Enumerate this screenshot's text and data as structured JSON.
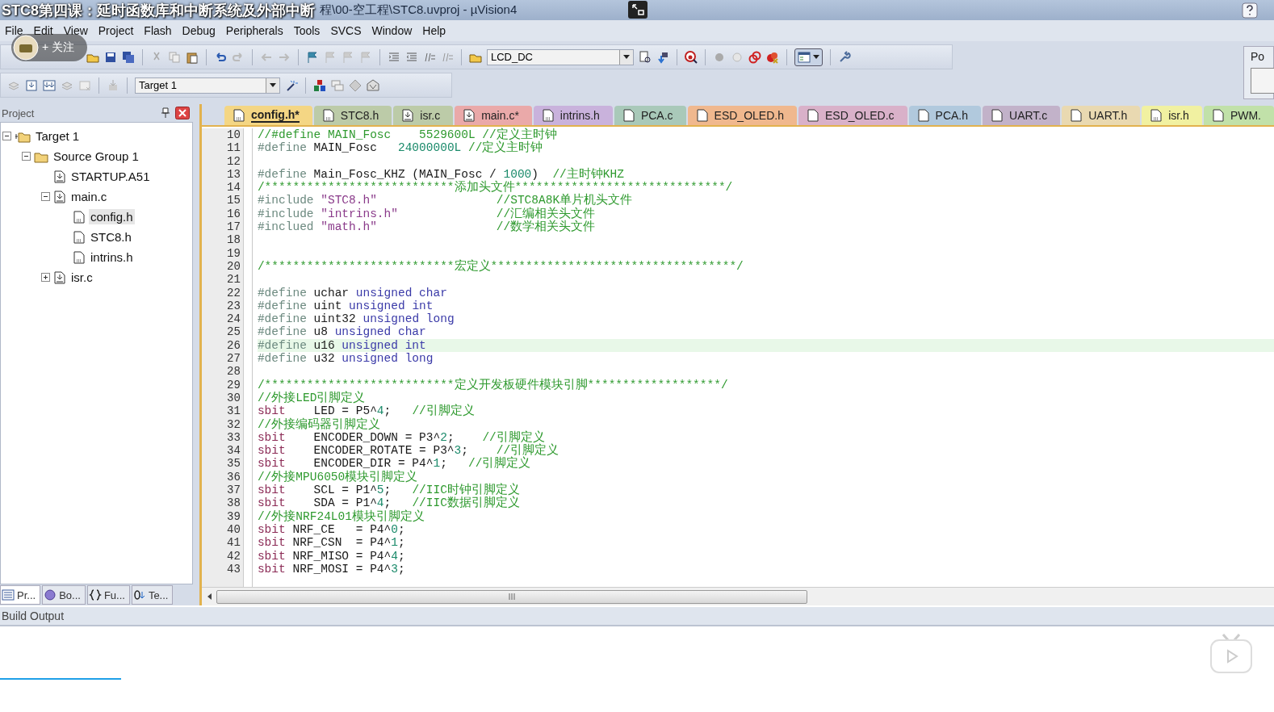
{
  "video_overlay": {
    "title": "STC8第四课：延时函数库和中断系统及外部中断",
    "follow_button": "+ 关注"
  },
  "window": {
    "title": "程\\00-空工程\\STC8.uvproj - µVision4"
  },
  "menu": [
    "File",
    "Edit",
    "View",
    "Project",
    "Flash",
    "Debug",
    "Peripherals",
    "Tools",
    "SVCS",
    "Window",
    "Help"
  ],
  "toolbar": {
    "device_combo": "LCD_DC",
    "target_combo": "Target 1"
  },
  "right_panel": {
    "label": "Po"
  },
  "side_panel": {
    "title": "Project",
    "tree": [
      {
        "label": "Target 1",
        "kind": "target",
        "expanded": true,
        "selected": false,
        "children": [
          {
            "label": "Source Group 1",
            "kind": "group",
            "expanded": true,
            "selected": false,
            "children": [
              {
                "label": "STARTUP.A51",
                "kind": "source",
                "selected": false
              },
              {
                "label": "main.c",
                "kind": "source",
                "expanded": true,
                "selected": false,
                "children": [
                  {
                    "label": "config.h",
                    "kind": "header",
                    "selected": true
                  },
                  {
                    "label": "STC8.h",
                    "kind": "header",
                    "selected": false
                  },
                  {
                    "label": "intrins.h",
                    "kind": "header",
                    "selected": false
                  }
                ]
              },
              {
                "label": "isr.c",
                "kind": "source",
                "expanded": false,
                "selected": false
              }
            ]
          }
        ]
      }
    ],
    "tabs": [
      {
        "label": "Pr...",
        "kind": "project",
        "selected": true
      },
      {
        "label": "Bo...",
        "kind": "books",
        "selected": false
      },
      {
        "label": "Fu...",
        "kind": "functions",
        "selected": false
      },
      {
        "label": "Te...",
        "kind": "templates",
        "selected": false
      }
    ]
  },
  "editor": {
    "tabs": [
      {
        "label": "config.h*",
        "kind": "header",
        "color": "#f4d684",
        "selected": true
      },
      {
        "label": "STC8.h",
        "kind": "header",
        "color": "#bccba8",
        "selected": false
      },
      {
        "label": "isr.c",
        "kind": "source",
        "color": "#bccba8",
        "selected": false
      },
      {
        "label": "main.c*",
        "kind": "source",
        "color": "#eaa9a9",
        "selected": false
      },
      {
        "label": "intrins.h",
        "kind": "header",
        "color": "#c9b2dc",
        "selected": false
      },
      {
        "label": "PCA.c",
        "kind": "plain",
        "color": "#a9c9b9",
        "selected": false
      },
      {
        "label": "ESD_OLED.h",
        "kind": "plain",
        "color": "#f0b88e",
        "selected": false
      },
      {
        "label": "ESD_OLED.c",
        "kind": "plain",
        "color": "#d9b1c9",
        "selected": false
      },
      {
        "label": "PCA.h",
        "kind": "plain",
        "color": "#b1c9dd",
        "selected": false
      },
      {
        "label": "UART.c",
        "kind": "plain",
        "color": "#c2b2c9",
        "selected": false
      },
      {
        "label": "UART.h",
        "kind": "plain",
        "color": "#e9d9b1",
        "selected": false
      },
      {
        "label": "isr.h",
        "kind": "header",
        "color": "#f1f1a1",
        "selected": false
      },
      {
        "label": "PWM.",
        "kind": "plain",
        "color": "#c1e1a9",
        "selected": false
      }
    ],
    "lines": [
      {
        "number": "10",
        "current": false,
        "tokens": [
          {
            "kind": "comment",
            "text": "//#define MAIN_Fosc    5529600L //定义主时钟"
          }
        ]
      },
      {
        "number": "11",
        "current": false,
        "tokens": [
          {
            "kind": "directive",
            "text": "#define"
          },
          {
            "kind": "plain",
            "text": " MAIN_Fosc   "
          },
          {
            "kind": "number",
            "text": "24000000L"
          },
          {
            "kind": "comment",
            "text": " //定义主时钟"
          }
        ]
      },
      {
        "number": "12",
        "current": false
      },
      {
        "number": "13",
        "current": false,
        "tokens": [
          {
            "kind": "directive",
            "text": "#define"
          },
          {
            "kind": "plain",
            "text": " Main_Fosc_KHZ (MAIN_Fosc / "
          },
          {
            "kind": "number",
            "text": "1000"
          },
          {
            "kind": "plain",
            "text": ")  "
          },
          {
            "kind": "comment",
            "text": "//主时钟KHZ"
          }
        ]
      },
      {
        "number": "14",
        "current": false,
        "tokens": [
          {
            "kind": "comment",
            "text": "/***************************添加头文件******************************/"
          }
        ]
      },
      {
        "number": "15",
        "current": false,
        "tokens": [
          {
            "kind": "directive",
            "text": "#include"
          },
          {
            "kind": "string",
            "text": " \"STC8.h\""
          },
          {
            "kind": "comment",
            "text": "                 //STC8A8K单片机头文件"
          }
        ]
      },
      {
        "number": "16",
        "current": false,
        "tokens": [
          {
            "kind": "directive",
            "text": "#include"
          },
          {
            "kind": "string",
            "text": " \"intrins.h\""
          },
          {
            "kind": "comment",
            "text": "              //汇编相关头文件"
          }
        ]
      },
      {
        "number": "17",
        "current": false,
        "tokens": [
          {
            "kind": "directive",
            "text": "#inclued"
          },
          {
            "kind": "string",
            "text": " \"math.h\""
          },
          {
            "kind": "comment",
            "text": "                 //数学相关头文件"
          }
        ]
      },
      {
        "number": "18",
        "current": false
      },
      {
        "number": "19",
        "current": false
      },
      {
        "number": "20",
        "current": false,
        "tokens": [
          {
            "kind": "comment",
            "text": "/***************************宏定义***********************************/"
          }
        ]
      },
      {
        "number": "21",
        "current": false
      },
      {
        "number": "22",
        "current": false,
        "tokens": [
          {
            "kind": "directive",
            "text": "#define"
          },
          {
            "kind": "plain",
            "text": " uchar "
          },
          {
            "kind": "keyword",
            "text": "unsigned char"
          }
        ]
      },
      {
        "number": "23",
        "current": false,
        "tokens": [
          {
            "kind": "directive",
            "text": "#define"
          },
          {
            "kind": "plain",
            "text": " uint "
          },
          {
            "kind": "keyword",
            "text": "unsigned int"
          }
        ]
      },
      {
        "number": "24",
        "current": false,
        "tokens": [
          {
            "kind": "directive",
            "text": "#define"
          },
          {
            "kind": "plain",
            "text": " uint32 "
          },
          {
            "kind": "keyword",
            "text": "unsigned long"
          }
        ]
      },
      {
        "number": "25",
        "current": false,
        "tokens": [
          {
            "kind": "directive",
            "text": "#define"
          },
          {
            "kind": "plain",
            "text": " u8 "
          },
          {
            "kind": "keyword",
            "text": "unsigned char"
          }
        ]
      },
      {
        "number": "26",
        "current": true,
        "tokens": [
          {
            "kind": "directive",
            "text": "#define"
          },
          {
            "kind": "plain",
            "text": " u16 "
          },
          {
            "kind": "keyword",
            "text": "unsigned int"
          }
        ]
      },
      {
        "number": "27",
        "current": false,
        "tokens": [
          {
            "kind": "directive",
            "text": "#define"
          },
          {
            "kind": "plain",
            "text": " u32 "
          },
          {
            "kind": "keyword",
            "text": "unsigned long"
          }
        ]
      },
      {
        "number": "28",
        "current": false
      },
      {
        "number": "29",
        "current": false,
        "tokens": [
          {
            "kind": "comment",
            "text": "/***************************定义开发板硬件模块引脚*******************/"
          }
        ]
      },
      {
        "number": "30",
        "current": false,
        "tokens": [
          {
            "kind": "comment",
            "text": "//外接LED引脚定义"
          }
        ]
      },
      {
        "number": "31",
        "current": false,
        "tokens": [
          {
            "kind": "type",
            "text": "sbit"
          },
          {
            "kind": "plain",
            "text": "    LED = P5^"
          },
          {
            "kind": "number",
            "text": "4"
          },
          {
            "kind": "plain",
            "text": ";   "
          },
          {
            "kind": "comment",
            "text": "//引脚定义"
          }
        ]
      },
      {
        "number": "32",
        "current": false,
        "tokens": [
          {
            "kind": "comment",
            "text": "//外接编码器引脚定义"
          }
        ]
      },
      {
        "number": "33",
        "current": false,
        "tokens": [
          {
            "kind": "type",
            "text": "sbit"
          },
          {
            "kind": "plain",
            "text": "    ENCODER_DOWN = P3^"
          },
          {
            "kind": "number",
            "text": "2"
          },
          {
            "kind": "plain",
            "text": ";    "
          },
          {
            "kind": "comment",
            "text": "//引脚定义"
          }
        ]
      },
      {
        "number": "34",
        "current": false,
        "tokens": [
          {
            "kind": "type",
            "text": "sbit"
          },
          {
            "kind": "plain",
            "text": "    ENCODER_ROTATE = P3^"
          },
          {
            "kind": "number",
            "text": "3"
          },
          {
            "kind": "plain",
            "text": ";    "
          },
          {
            "kind": "comment",
            "text": "//引脚定义"
          }
        ]
      },
      {
        "number": "35",
        "current": false,
        "tokens": [
          {
            "kind": "type",
            "text": "sbit"
          },
          {
            "kind": "plain",
            "text": "    ENCODER_DIR = P4^"
          },
          {
            "kind": "number",
            "text": "1"
          },
          {
            "kind": "plain",
            "text": ";   "
          },
          {
            "kind": "comment",
            "text": "//引脚定义"
          }
        ]
      },
      {
        "number": "36",
        "current": false,
        "tokens": [
          {
            "kind": "comment",
            "text": "//外接MPU6050模块引脚定义"
          }
        ]
      },
      {
        "number": "37",
        "current": false,
        "tokens": [
          {
            "kind": "type",
            "text": "sbit"
          },
          {
            "kind": "plain",
            "text": "    SCL = P1^"
          },
          {
            "kind": "number",
            "text": "5"
          },
          {
            "kind": "plain",
            "text": ";   "
          },
          {
            "kind": "comment",
            "text": "//IIC时钟引脚定义"
          }
        ]
      },
      {
        "number": "38",
        "current": false,
        "tokens": [
          {
            "kind": "type",
            "text": "sbit"
          },
          {
            "kind": "plain",
            "text": "    SDA = P1^"
          },
          {
            "kind": "number",
            "text": "4"
          },
          {
            "kind": "plain",
            "text": ";   "
          },
          {
            "kind": "comment",
            "text": "//IIC数据引脚定义"
          }
        ]
      },
      {
        "number": "39",
        "current": false,
        "tokens": [
          {
            "kind": "comment",
            "text": "//外接NRF24L01模块引脚定义"
          }
        ]
      },
      {
        "number": "40",
        "current": false,
        "tokens": [
          {
            "kind": "type",
            "text": "sbit"
          },
          {
            "kind": "plain",
            "text": " NRF_CE   = P4^"
          },
          {
            "kind": "number",
            "text": "0"
          },
          {
            "kind": "plain",
            "text": ";"
          }
        ]
      },
      {
        "number": "41",
        "current": false,
        "tokens": [
          {
            "kind": "type",
            "text": "sbit"
          },
          {
            "kind": "plain",
            "text": " NRF_CSN  = P4^"
          },
          {
            "kind": "number",
            "text": "1"
          },
          {
            "kind": "plain",
            "text": ";"
          }
        ]
      },
      {
        "number": "42",
        "current": false,
        "tokens": [
          {
            "kind": "type",
            "text": "sbit"
          },
          {
            "kind": "plain",
            "text": " NRF_MISO = P4^"
          },
          {
            "kind": "number",
            "text": "4"
          },
          {
            "kind": "plain",
            "text": ";"
          }
        ]
      },
      {
        "number": "43",
        "current": false,
        "tokens": [
          {
            "kind": "type",
            "text": "sbit"
          },
          {
            "kind": "plain",
            "text": " NRF_MOSI = P4^"
          },
          {
            "kind": "number",
            "text": "3"
          },
          {
            "kind": "plain",
            "text": ";"
          }
        ]
      }
    ]
  },
  "build_output": {
    "title": "Build Output"
  },
  "player": {
    "progress": {
      "level": 0.095
    }
  }
}
